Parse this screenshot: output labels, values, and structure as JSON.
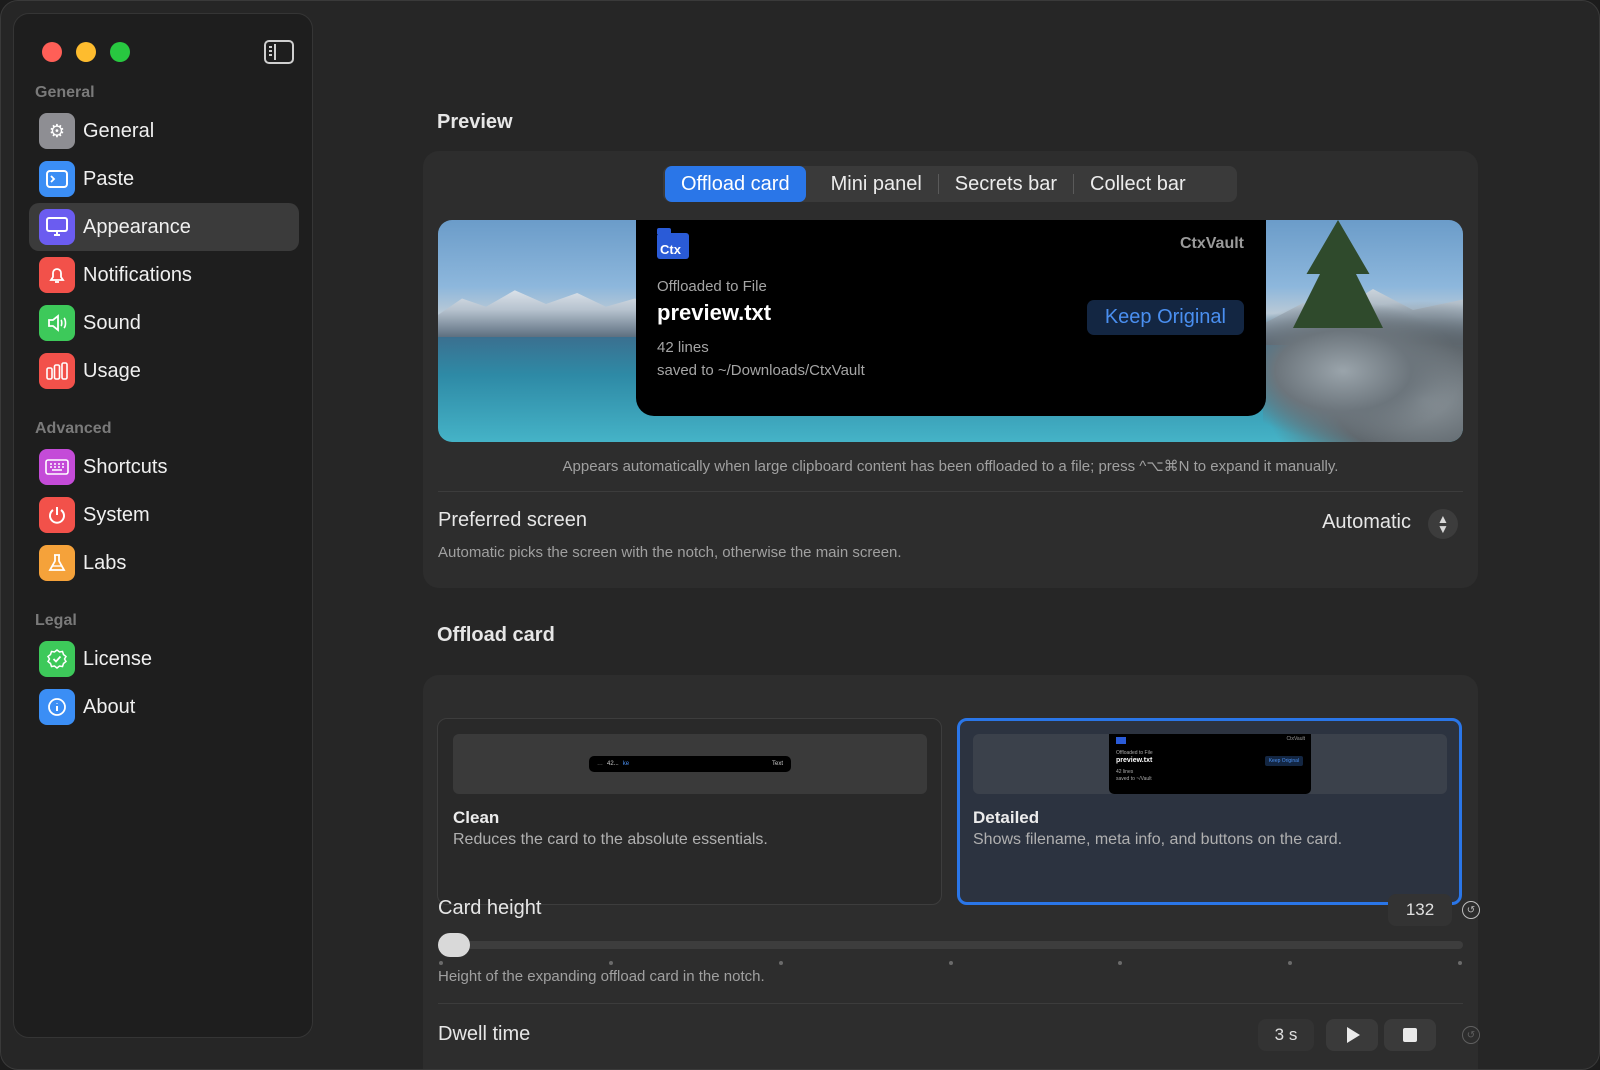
{
  "sidebar": {
    "sections": [
      {
        "label": "General",
        "items": [
          {
            "label": "General",
            "icon": "gear-icon",
            "color": "#8e8e93"
          },
          {
            "label": "Paste",
            "icon": "terminal-icon",
            "color": "#3b8ef5"
          },
          {
            "label": "Appearance",
            "icon": "display-icon",
            "color": "#6b5cf0",
            "active": true
          },
          {
            "label": "Notifications",
            "icon": "bell-icon",
            "color": "#f2514a"
          },
          {
            "label": "Sound",
            "icon": "speaker-icon",
            "color": "#3dc95a"
          },
          {
            "label": "Usage",
            "icon": "bars-icon",
            "color": "#f2514a"
          }
        ]
      },
      {
        "label": "Advanced",
        "items": [
          {
            "label": "Shortcuts",
            "icon": "keyboard-icon",
            "color": "#c44bd8"
          },
          {
            "label": "System",
            "icon": "power-icon",
            "color": "#f2514a"
          },
          {
            "label": "Labs",
            "icon": "flask-icon",
            "color": "#f5a23a"
          }
        ]
      },
      {
        "label": "Legal",
        "items": [
          {
            "label": "License",
            "icon": "seal-check-icon",
            "color": "#3dc95a"
          },
          {
            "label": "About",
            "icon": "info-icon",
            "color": "#3b8ef5"
          }
        ]
      }
    ]
  },
  "preview": {
    "heading": "Preview",
    "tabs": [
      "Offload card",
      "Mini panel",
      "Secrets bar",
      "Collect bar"
    ],
    "active_tab": "Offload card",
    "card": {
      "logo_text": "Ctx",
      "brand": "CtxVault",
      "subtitle": "Offloaded to File",
      "filename": "preview.txt",
      "lines": "42 lines",
      "saved_to": "saved to ~/Downloads/CtxVault",
      "button": "Keep Original"
    },
    "caption": "Appears automatically when large clipboard content has been offloaded to a file; press ^⌥⌘N to expand it manually.",
    "preferred_screen": {
      "label": "Preferred screen",
      "value": "Automatic",
      "description": "Automatic picks the screen with the notch, otherwise the main screen."
    }
  },
  "offload_card": {
    "heading": "Offload card",
    "options": [
      {
        "title": "Clean",
        "description": "Reduces the card to the absolute essentials.",
        "thumb_left": "42...",
        "thumb_mid": "ke",
        "thumb_right": "Text",
        "selected": false
      },
      {
        "title": "Detailed",
        "description": "Shows filename, meta info, and buttons on the card.",
        "selected": true,
        "thumb": {
          "logo": "Ctx",
          "brand": "CtxVault",
          "sub": "Offloaded to File",
          "file": "preview.txt",
          "lines": "42 lines",
          "saved": "saved to ~/Vault",
          "button": "Keep Original"
        }
      }
    ],
    "card_height": {
      "label": "Card height",
      "value": "132",
      "description": "Height of the expanding offload card in the notch.",
      "slider_fraction": 0.0,
      "tick_count": 7
    },
    "dwell_time": {
      "label": "Dwell time",
      "value": "3 s"
    }
  },
  "colors": {
    "accent": "#2a76e8",
    "link": "#4a8ff0"
  }
}
